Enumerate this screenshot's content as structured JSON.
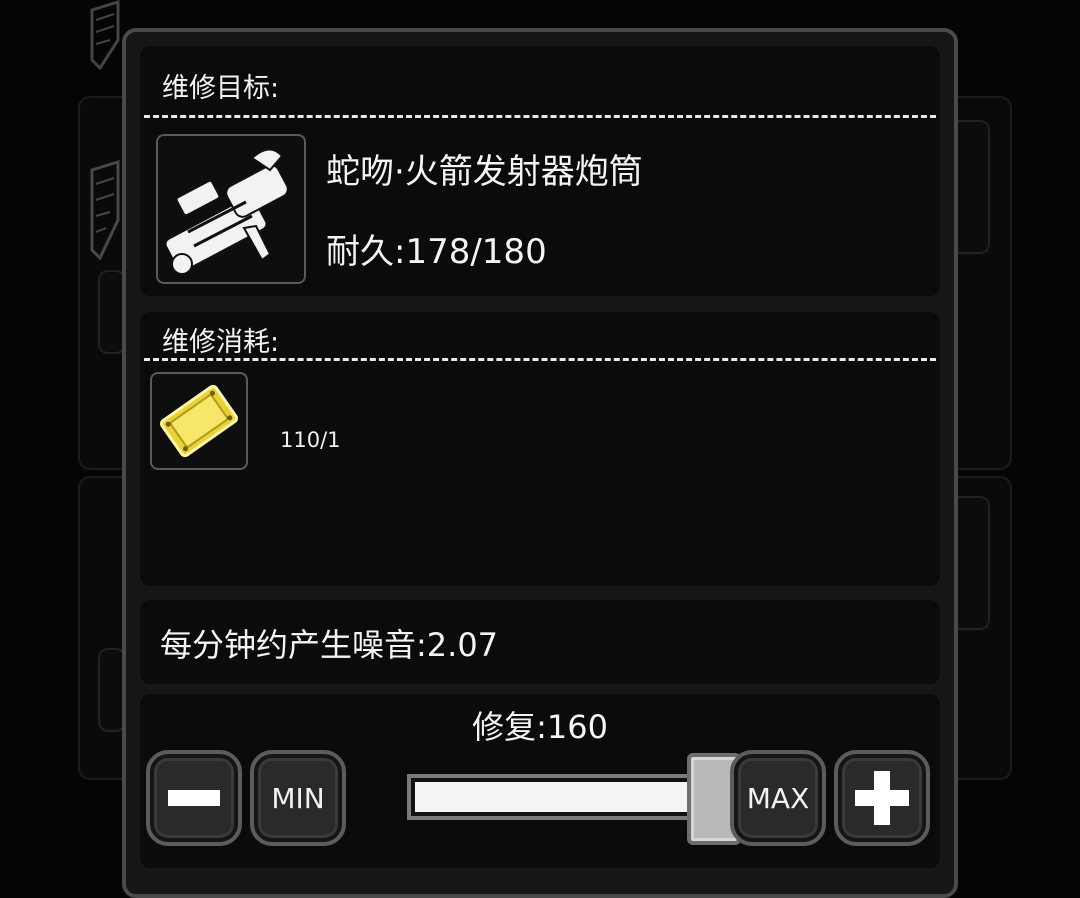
{
  "repair_target": {
    "title": "维修目标:",
    "item_name": "蛇吻·火箭发射器炮筒",
    "durability_text": "耐久:178/180",
    "item_icon": "rocket-launcher-barrel-icon"
  },
  "repair_cost": {
    "title": "维修消耗:",
    "material_icon": "gold-plate-icon",
    "material_amount": "110/1"
  },
  "noise": {
    "text": "每分钟约产生噪音:2.07"
  },
  "repair_control": {
    "label": "修复:160",
    "min_label": "MIN",
    "max_label": "MAX",
    "minus_icon": "minus-icon",
    "plus_icon": "plus-icon",
    "slider_fraction": 0.95
  },
  "colors": {
    "panel_bg": "#0b0b0b",
    "dialog_border": "#4a4a4a",
    "gold": "#e8d23a"
  }
}
